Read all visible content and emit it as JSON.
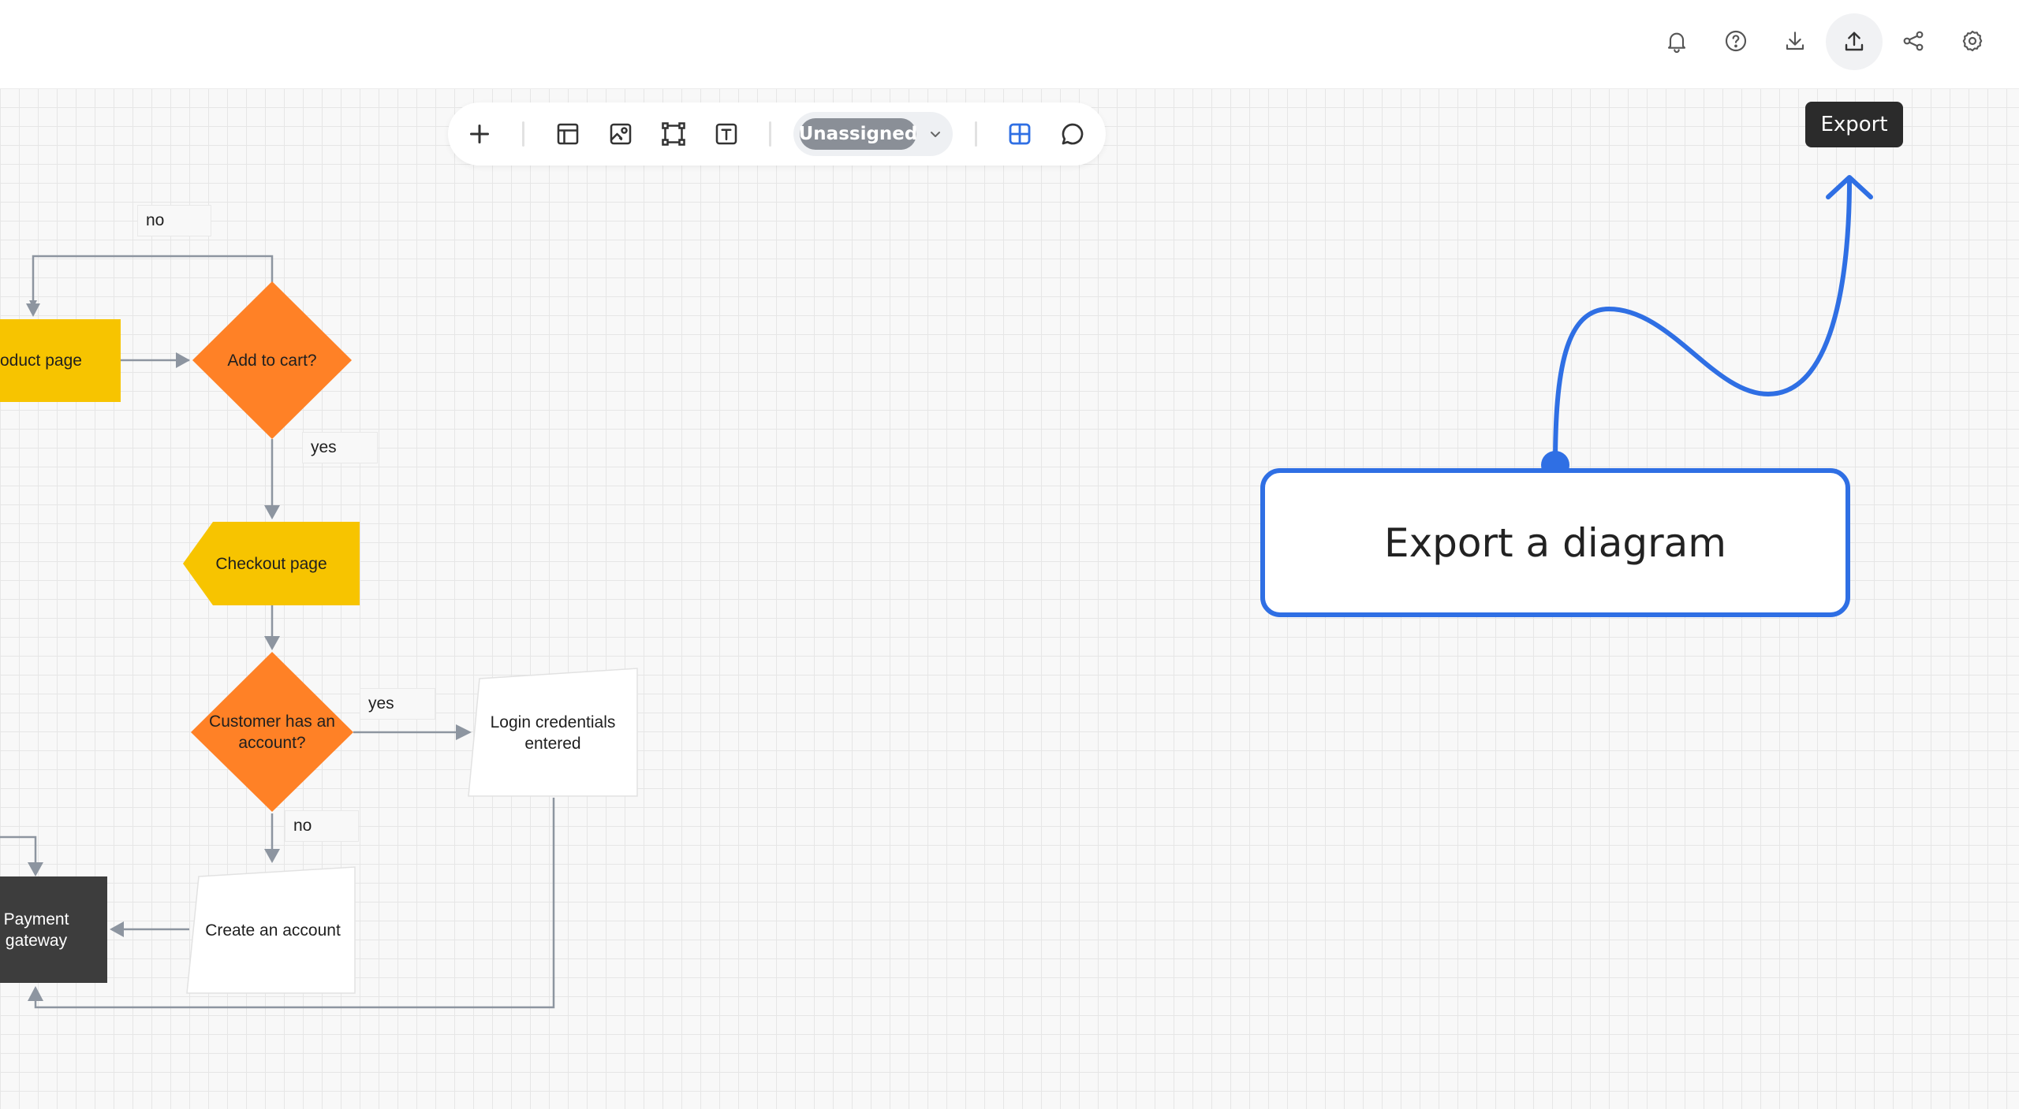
{
  "header": {
    "icons": [
      {
        "name": "bell-icon"
      },
      {
        "name": "help-icon"
      },
      {
        "name": "download-icon"
      },
      {
        "name": "export-icon"
      },
      {
        "name": "share-icon"
      },
      {
        "name": "settings-icon"
      }
    ],
    "tooltip": "Export"
  },
  "toolbar": {
    "tools": [
      {
        "name": "add-icon"
      },
      {
        "name": "template-icon"
      },
      {
        "name": "image-icon"
      },
      {
        "name": "frame-icon"
      },
      {
        "name": "text-icon"
      },
      {
        "name": "grid-icon"
      },
      {
        "name": "comment-icon"
      }
    ],
    "status_label": "Unassigned"
  },
  "diagram": {
    "nodes": {
      "product_page": "oduct page",
      "add_to_cart": "Add to cart?",
      "checkout_page": "Checkout page",
      "customer_account": "Customer has an account?",
      "login": "Login credentials entered",
      "create_account": "Create an account",
      "payment": "Payment gateway"
    },
    "edge_labels": {
      "no_top": "no",
      "yes_cart": "yes",
      "yes_account": "yes",
      "no_account": "no"
    }
  },
  "callout": {
    "text": "Export a diagram",
    "color": "#2f6fe4"
  },
  "colors": {
    "yellow": "#f7c400",
    "orange": "#ff8126",
    "dark": "#3d3d3d",
    "edge": "#8d95a0",
    "accent": "#2f6fe4"
  }
}
